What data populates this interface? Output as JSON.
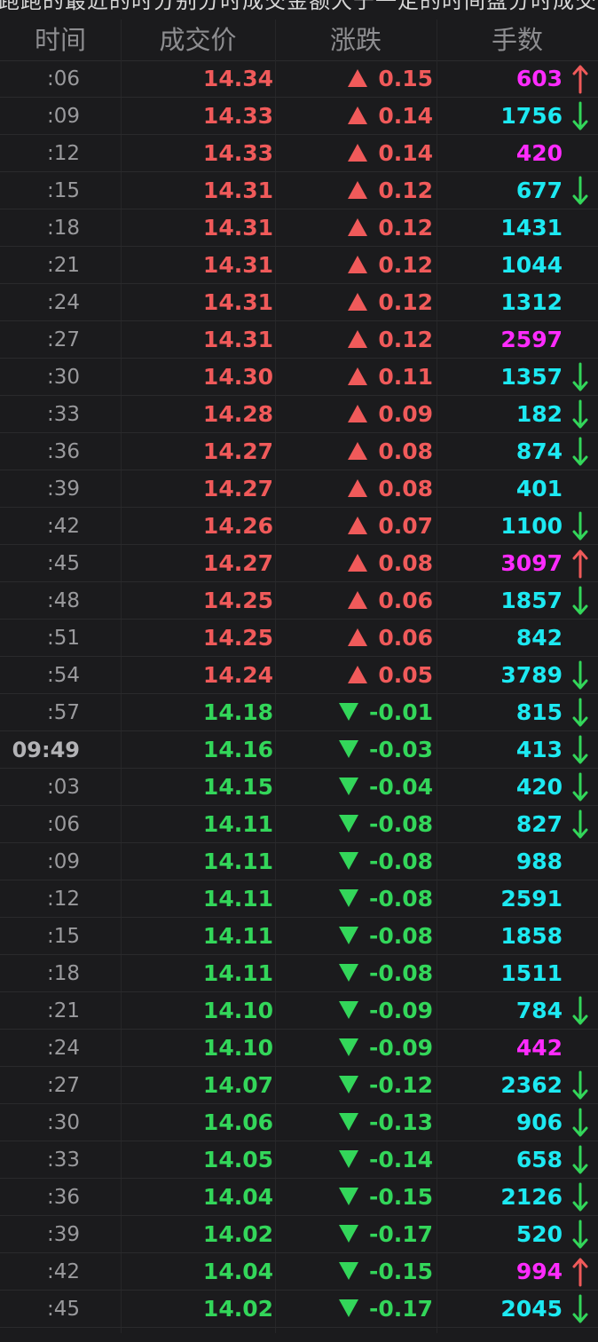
{
  "top_text": "跑跑的最近的时分别分时成交金额大于一定的时间盘分时成交",
  "header": {
    "time": "时间",
    "price": "成交价",
    "change": "涨跌",
    "volume": "手数"
  },
  "colors": {
    "up": "#f05a5a",
    "down": "#33d65a",
    "vol_magenta": "#ff2bff",
    "vol_cyan": "#1de9f2",
    "arrow_up": "#f05a5a",
    "arrow_down": "#33d65a"
  },
  "rows": [
    {
      "time": ":06",
      "price": "14.34",
      "change": "0.15",
      "dir": "up",
      "volume": "603",
      "vol_color": "magenta",
      "arrow": "up"
    },
    {
      "time": ":09",
      "price": "14.33",
      "change": "0.14",
      "dir": "up",
      "volume": "1756",
      "vol_color": "cyan",
      "arrow": "down"
    },
    {
      "time": ":12",
      "price": "14.33",
      "change": "0.14",
      "dir": "up",
      "volume": "420",
      "vol_color": "magenta",
      "arrow": "none"
    },
    {
      "time": ":15",
      "price": "14.31",
      "change": "0.12",
      "dir": "up",
      "volume": "677",
      "vol_color": "cyan",
      "arrow": "down"
    },
    {
      "time": ":18",
      "price": "14.31",
      "change": "0.12",
      "dir": "up",
      "volume": "1431",
      "vol_color": "cyan",
      "arrow": "none"
    },
    {
      "time": ":21",
      "price": "14.31",
      "change": "0.12",
      "dir": "up",
      "volume": "1044",
      "vol_color": "cyan",
      "arrow": "none"
    },
    {
      "time": ":24",
      "price": "14.31",
      "change": "0.12",
      "dir": "up",
      "volume": "1312",
      "vol_color": "cyan",
      "arrow": "none"
    },
    {
      "time": ":27",
      "price": "14.31",
      "change": "0.12",
      "dir": "up",
      "volume": "2597",
      "vol_color": "magenta",
      "arrow": "none"
    },
    {
      "time": ":30",
      "price": "14.30",
      "change": "0.11",
      "dir": "up",
      "volume": "1357",
      "vol_color": "cyan",
      "arrow": "down"
    },
    {
      "time": ":33",
      "price": "14.28",
      "change": "0.09",
      "dir": "up",
      "volume": "182",
      "vol_color": "cyan",
      "arrow": "down"
    },
    {
      "time": ":36",
      "price": "14.27",
      "change": "0.08",
      "dir": "up",
      "volume": "874",
      "vol_color": "cyan",
      "arrow": "down"
    },
    {
      "time": ":39",
      "price": "14.27",
      "change": "0.08",
      "dir": "up",
      "volume": "401",
      "vol_color": "cyan",
      "arrow": "none"
    },
    {
      "time": ":42",
      "price": "14.26",
      "change": "0.07",
      "dir": "up",
      "volume": "1100",
      "vol_color": "cyan",
      "arrow": "down"
    },
    {
      "time": ":45",
      "price": "14.27",
      "change": "0.08",
      "dir": "up",
      "volume": "3097",
      "vol_color": "magenta",
      "arrow": "up"
    },
    {
      "time": ":48",
      "price": "14.25",
      "change": "0.06",
      "dir": "up",
      "volume": "1857",
      "vol_color": "cyan",
      "arrow": "down"
    },
    {
      "time": ":51",
      "price": "14.25",
      "change": "0.06",
      "dir": "up",
      "volume": "842",
      "vol_color": "cyan",
      "arrow": "none"
    },
    {
      "time": ":54",
      "price": "14.24",
      "change": "0.05",
      "dir": "up",
      "volume": "3789",
      "vol_color": "cyan",
      "arrow": "down"
    },
    {
      "time": ":57",
      "price": "14.18",
      "change": "-0.01",
      "dir": "down",
      "volume": "815",
      "vol_color": "cyan",
      "arrow": "down"
    },
    {
      "time": "09:49",
      "price": "14.16",
      "change": "-0.03",
      "dir": "down",
      "volume": "413",
      "vol_color": "cyan",
      "arrow": "down",
      "full": true
    },
    {
      "time": ":03",
      "price": "14.15",
      "change": "-0.04",
      "dir": "down",
      "volume": "420",
      "vol_color": "cyan",
      "arrow": "down"
    },
    {
      "time": ":06",
      "price": "14.11",
      "change": "-0.08",
      "dir": "down",
      "volume": "827",
      "vol_color": "cyan",
      "arrow": "down"
    },
    {
      "time": ":09",
      "price": "14.11",
      "change": "-0.08",
      "dir": "down",
      "volume": "988",
      "vol_color": "cyan",
      "arrow": "none"
    },
    {
      "time": ":12",
      "price": "14.11",
      "change": "-0.08",
      "dir": "down",
      "volume": "2591",
      "vol_color": "cyan",
      "arrow": "none"
    },
    {
      "time": ":15",
      "price": "14.11",
      "change": "-0.08",
      "dir": "down",
      "volume": "1858",
      "vol_color": "cyan",
      "arrow": "none"
    },
    {
      "time": ":18",
      "price": "14.11",
      "change": "-0.08",
      "dir": "down",
      "volume": "1511",
      "vol_color": "cyan",
      "arrow": "none"
    },
    {
      "time": ":21",
      "price": "14.10",
      "change": "-0.09",
      "dir": "down",
      "volume": "784",
      "vol_color": "cyan",
      "arrow": "down"
    },
    {
      "time": ":24",
      "price": "14.10",
      "change": "-0.09",
      "dir": "down",
      "volume": "442",
      "vol_color": "magenta",
      "arrow": "none"
    },
    {
      "time": ":27",
      "price": "14.07",
      "change": "-0.12",
      "dir": "down",
      "volume": "2362",
      "vol_color": "cyan",
      "arrow": "down"
    },
    {
      "time": ":30",
      "price": "14.06",
      "change": "-0.13",
      "dir": "down",
      "volume": "906",
      "vol_color": "cyan",
      "arrow": "down"
    },
    {
      "time": ":33",
      "price": "14.05",
      "change": "-0.14",
      "dir": "down",
      "volume": "658",
      "vol_color": "cyan",
      "arrow": "down"
    },
    {
      "time": ":36",
      "price": "14.04",
      "change": "-0.15",
      "dir": "down",
      "volume": "2126",
      "vol_color": "cyan",
      "arrow": "down"
    },
    {
      "time": ":39",
      "price": "14.02",
      "change": "-0.17",
      "dir": "down",
      "volume": "520",
      "vol_color": "cyan",
      "arrow": "down"
    },
    {
      "time": ":42",
      "price": "14.04",
      "change": "-0.15",
      "dir": "down",
      "volume": "994",
      "vol_color": "magenta",
      "arrow": "up"
    },
    {
      "time": ":45",
      "price": "14.02",
      "change": "-0.17",
      "dir": "down",
      "volume": "2045",
      "vol_color": "cyan",
      "arrow": "down"
    }
  ]
}
